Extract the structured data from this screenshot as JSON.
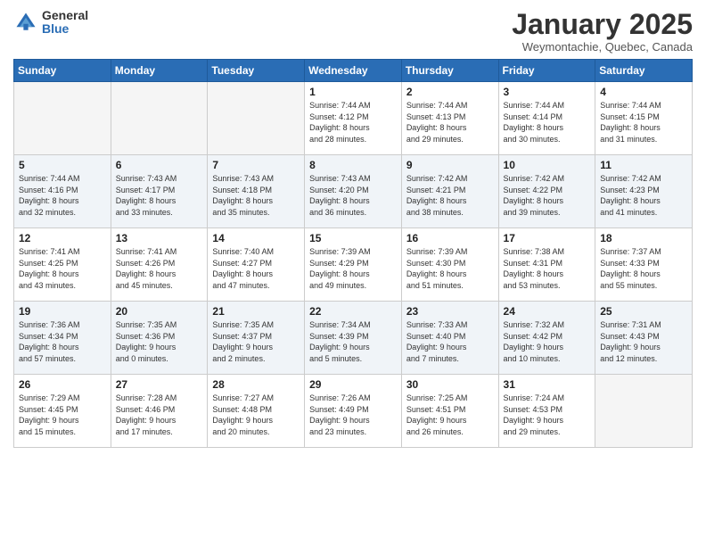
{
  "logo": {
    "general": "General",
    "blue": "Blue"
  },
  "header": {
    "title": "January 2025",
    "subtitle": "Weymontachie, Quebec, Canada"
  },
  "weekdays": [
    "Sunday",
    "Monday",
    "Tuesday",
    "Wednesday",
    "Thursday",
    "Friday",
    "Saturday"
  ],
  "weeks": [
    [
      {
        "day": "",
        "info": ""
      },
      {
        "day": "",
        "info": ""
      },
      {
        "day": "",
        "info": ""
      },
      {
        "day": "1",
        "info": "Sunrise: 7:44 AM\nSunset: 4:12 PM\nDaylight: 8 hours\nand 28 minutes."
      },
      {
        "day": "2",
        "info": "Sunrise: 7:44 AM\nSunset: 4:13 PM\nDaylight: 8 hours\nand 29 minutes."
      },
      {
        "day": "3",
        "info": "Sunrise: 7:44 AM\nSunset: 4:14 PM\nDaylight: 8 hours\nand 30 minutes."
      },
      {
        "day": "4",
        "info": "Sunrise: 7:44 AM\nSunset: 4:15 PM\nDaylight: 8 hours\nand 31 minutes."
      }
    ],
    [
      {
        "day": "5",
        "info": "Sunrise: 7:44 AM\nSunset: 4:16 PM\nDaylight: 8 hours\nand 32 minutes."
      },
      {
        "day": "6",
        "info": "Sunrise: 7:43 AM\nSunset: 4:17 PM\nDaylight: 8 hours\nand 33 minutes."
      },
      {
        "day": "7",
        "info": "Sunrise: 7:43 AM\nSunset: 4:18 PM\nDaylight: 8 hours\nand 35 minutes."
      },
      {
        "day": "8",
        "info": "Sunrise: 7:43 AM\nSunset: 4:20 PM\nDaylight: 8 hours\nand 36 minutes."
      },
      {
        "day": "9",
        "info": "Sunrise: 7:42 AM\nSunset: 4:21 PM\nDaylight: 8 hours\nand 38 minutes."
      },
      {
        "day": "10",
        "info": "Sunrise: 7:42 AM\nSunset: 4:22 PM\nDaylight: 8 hours\nand 39 minutes."
      },
      {
        "day": "11",
        "info": "Sunrise: 7:42 AM\nSunset: 4:23 PM\nDaylight: 8 hours\nand 41 minutes."
      }
    ],
    [
      {
        "day": "12",
        "info": "Sunrise: 7:41 AM\nSunset: 4:25 PM\nDaylight: 8 hours\nand 43 minutes."
      },
      {
        "day": "13",
        "info": "Sunrise: 7:41 AM\nSunset: 4:26 PM\nDaylight: 8 hours\nand 45 minutes."
      },
      {
        "day": "14",
        "info": "Sunrise: 7:40 AM\nSunset: 4:27 PM\nDaylight: 8 hours\nand 47 minutes."
      },
      {
        "day": "15",
        "info": "Sunrise: 7:39 AM\nSunset: 4:29 PM\nDaylight: 8 hours\nand 49 minutes."
      },
      {
        "day": "16",
        "info": "Sunrise: 7:39 AM\nSunset: 4:30 PM\nDaylight: 8 hours\nand 51 minutes."
      },
      {
        "day": "17",
        "info": "Sunrise: 7:38 AM\nSunset: 4:31 PM\nDaylight: 8 hours\nand 53 minutes."
      },
      {
        "day": "18",
        "info": "Sunrise: 7:37 AM\nSunset: 4:33 PM\nDaylight: 8 hours\nand 55 minutes."
      }
    ],
    [
      {
        "day": "19",
        "info": "Sunrise: 7:36 AM\nSunset: 4:34 PM\nDaylight: 8 hours\nand 57 minutes."
      },
      {
        "day": "20",
        "info": "Sunrise: 7:35 AM\nSunset: 4:36 PM\nDaylight: 9 hours\nand 0 minutes."
      },
      {
        "day": "21",
        "info": "Sunrise: 7:35 AM\nSunset: 4:37 PM\nDaylight: 9 hours\nand 2 minutes."
      },
      {
        "day": "22",
        "info": "Sunrise: 7:34 AM\nSunset: 4:39 PM\nDaylight: 9 hours\nand 5 minutes."
      },
      {
        "day": "23",
        "info": "Sunrise: 7:33 AM\nSunset: 4:40 PM\nDaylight: 9 hours\nand 7 minutes."
      },
      {
        "day": "24",
        "info": "Sunrise: 7:32 AM\nSunset: 4:42 PM\nDaylight: 9 hours\nand 10 minutes."
      },
      {
        "day": "25",
        "info": "Sunrise: 7:31 AM\nSunset: 4:43 PM\nDaylight: 9 hours\nand 12 minutes."
      }
    ],
    [
      {
        "day": "26",
        "info": "Sunrise: 7:29 AM\nSunset: 4:45 PM\nDaylight: 9 hours\nand 15 minutes."
      },
      {
        "day": "27",
        "info": "Sunrise: 7:28 AM\nSunset: 4:46 PM\nDaylight: 9 hours\nand 17 minutes."
      },
      {
        "day": "28",
        "info": "Sunrise: 7:27 AM\nSunset: 4:48 PM\nDaylight: 9 hours\nand 20 minutes."
      },
      {
        "day": "29",
        "info": "Sunrise: 7:26 AM\nSunset: 4:49 PM\nDaylight: 9 hours\nand 23 minutes."
      },
      {
        "day": "30",
        "info": "Sunrise: 7:25 AM\nSunset: 4:51 PM\nDaylight: 9 hours\nand 26 minutes."
      },
      {
        "day": "31",
        "info": "Sunrise: 7:24 AM\nSunset: 4:53 PM\nDaylight: 9 hours\nand 29 minutes."
      },
      {
        "day": "",
        "info": ""
      }
    ]
  ]
}
